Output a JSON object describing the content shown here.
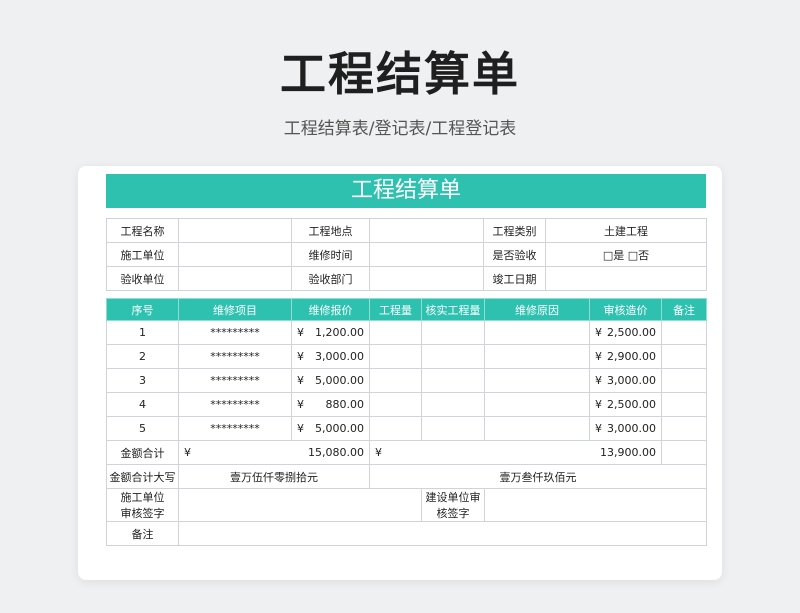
{
  "header": {
    "title": "工程结算单",
    "subtitle": "工程结算表/登记表/工程登记表"
  },
  "sheet": {
    "title": "工程结算单"
  },
  "info": [
    [
      "工程名称",
      "",
      "工程地点",
      "",
      "工程类别",
      "土建工程"
    ],
    [
      "施工单位",
      "",
      "维修时间",
      "",
      "是否验收",
      "□是 □否"
    ],
    [
      "验收单位",
      "",
      "验收部门",
      "",
      "竣工日期",
      ""
    ]
  ],
  "columns": [
    "序号",
    "维修项目",
    "维修报价",
    "工程量",
    "核实工程量",
    "维修原因",
    "审核造价",
    "备注"
  ],
  "currency": "¥",
  "rows": [
    {
      "no": "1",
      "item": "*********",
      "quote": "1,200.00",
      "audit": "2,500.00"
    },
    {
      "no": "2",
      "item": "*********",
      "quote": "3,000.00",
      "audit": "2,900.00"
    },
    {
      "no": "3",
      "item": "*********",
      "quote": "5,000.00",
      "audit": "3,000.00"
    },
    {
      "no": "4",
      "item": "*********",
      "quote": "880.00",
      "audit": "2,500.00"
    },
    {
      "no": "5",
      "item": "*********",
      "quote": "5,000.00",
      "audit": "3,000.00"
    }
  ],
  "totals": {
    "label": "金额合计",
    "quote_total": "15,080.00",
    "audit_total": "13,900.00",
    "upper_label": "金额合计大写",
    "quote_upper": "壹万伍仟零捌拾元",
    "audit_upper": "壹万叁仟玖佰元"
  },
  "signatures": {
    "left_line1": "施工单位",
    "left_line2": "审核签字",
    "right_line1": "建设单位审",
    "right_line2": "核签字"
  },
  "remark_label": "备注"
}
